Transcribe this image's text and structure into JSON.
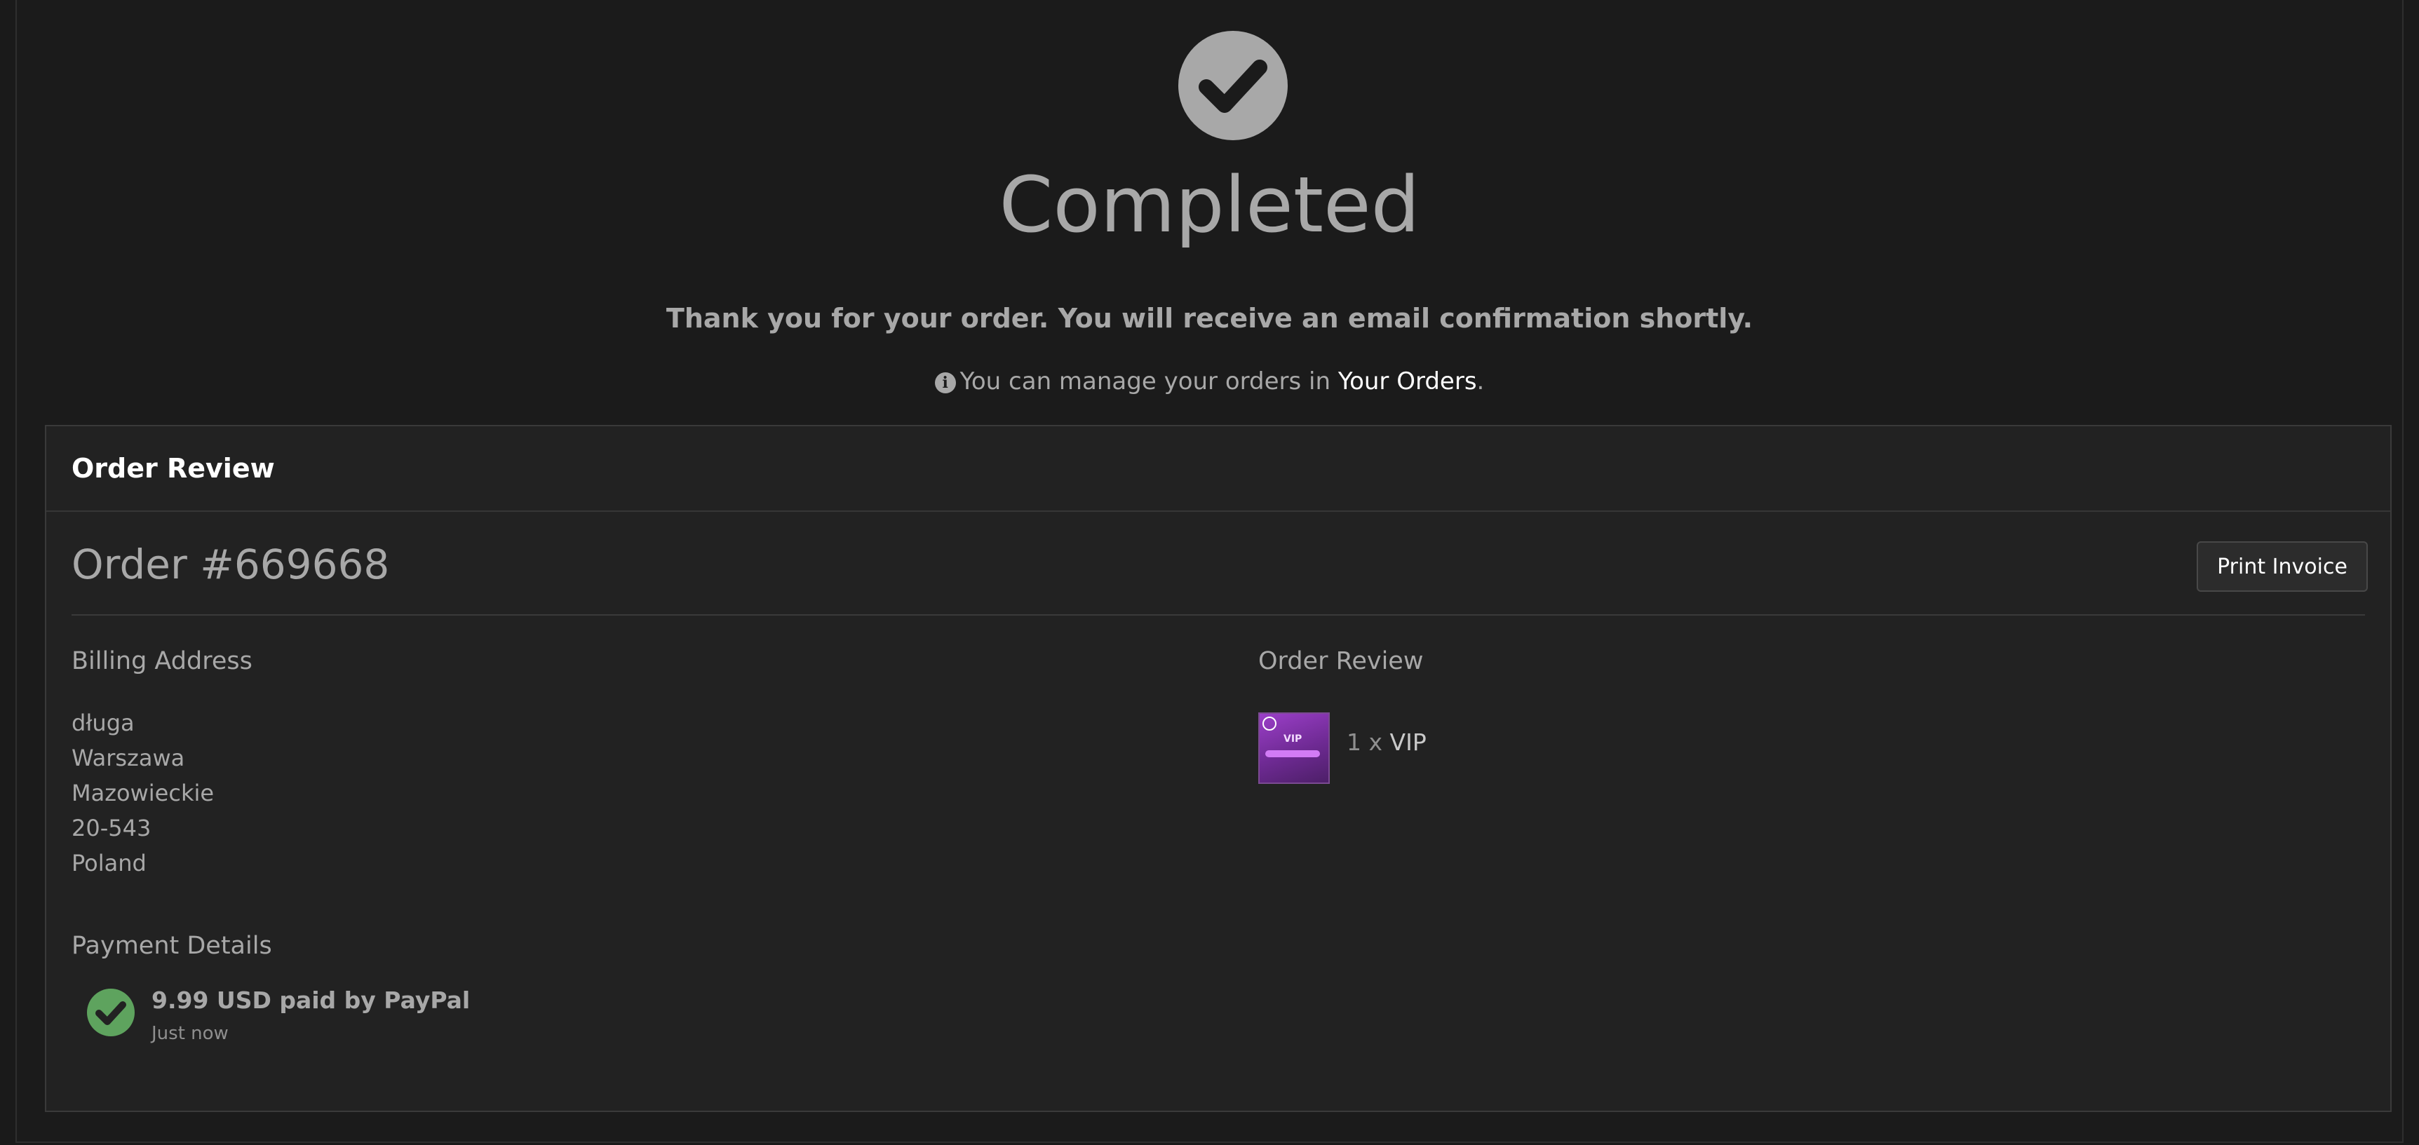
{
  "hero": {
    "icon": "check-circle-icon",
    "title": "Completed",
    "thanks": "Thank you for your order. You will receive an email confirmation shortly.",
    "manage_prefix": "You can manage your orders in ",
    "manage_link": "Your Orders",
    "manage_suffix": "."
  },
  "panel": {
    "heading": "Order Review",
    "order_title": "Order #669668",
    "print_button": "Print Invoice",
    "billing": {
      "label": "Billing Address",
      "lines": [
        "długa",
        "Warszawa",
        "Mazowieckie",
        "20-543",
        "Poland"
      ]
    },
    "payment": {
      "label": "Payment Details",
      "main": "9.99 USD paid by PayPal",
      "sub": "Just now"
    },
    "review": {
      "label": "Order Review",
      "items": [
        {
          "qty": "1 x ",
          "name": "VIP",
          "thumb_text": "VIP"
        }
      ]
    }
  },
  "colors": {
    "background": "#1b1b1b",
    "panel": "#222222",
    "text": "#a8a8a8",
    "success": "#5ea35e",
    "link": "#ffffff"
  }
}
